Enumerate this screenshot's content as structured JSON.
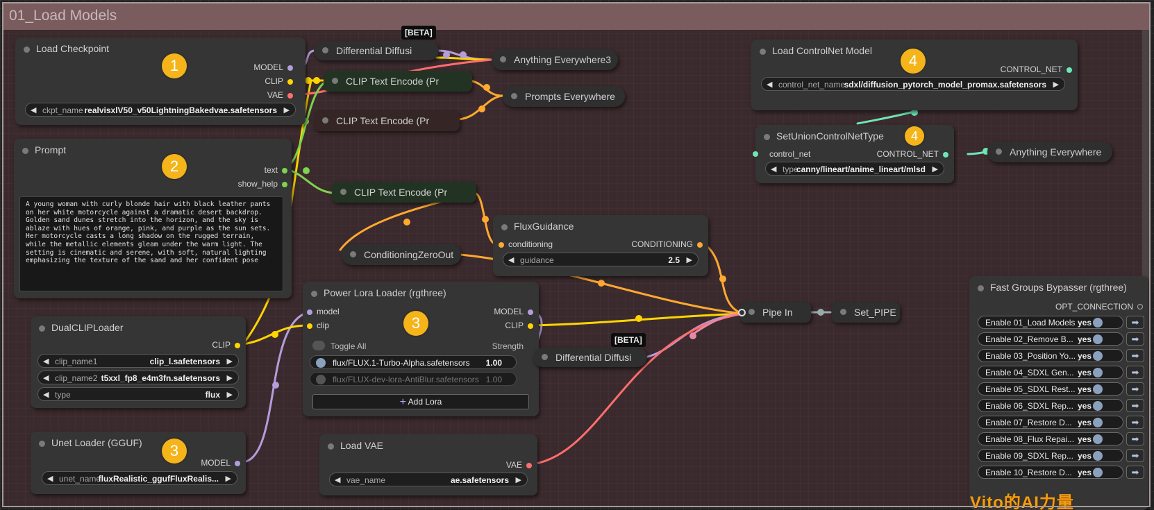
{
  "group": {
    "title": "01_Load Models"
  },
  "badges": {
    "b1": "1",
    "b2": "2",
    "b3a": "3",
    "b3b": "3",
    "b4a": "4",
    "b4b": "4"
  },
  "beta_label": "[BETA]",
  "load_checkpoint": {
    "title": "Load Checkpoint",
    "outputs": [
      "MODEL",
      "CLIP",
      "VAE"
    ],
    "widget": {
      "label": "ckpt_name",
      "value": "realvisxlV50_v50LightningBakedvae.safetensors"
    }
  },
  "prompt": {
    "title": "Prompt",
    "outputs": [
      "text",
      "show_help"
    ],
    "text": "A young woman with curly blonde hair with black leather pants on her white motorcycle against a dramatic desert backdrop. Golden sand dunes stretch into the horizon, and the sky is ablaze with hues of orange, pink, and purple as the sun sets. Her motorcycle casts a long shadow on the rugged terrain, while the metallic elements gleam under the warm light. The setting is cinematic and serene, with soft, natural lighting emphasizing the texture of the sand and her confident pose"
  },
  "differential_diffusion_1": {
    "title": "Differential Diffusi"
  },
  "differential_diffusion_2": {
    "title": "Differential Diffusi"
  },
  "anything_everywhere3": {
    "title": "Anything Everywhere3"
  },
  "clip_text_encode_1": {
    "title": "CLIP Text Encode (Pr"
  },
  "clip_text_encode_2": {
    "title": "CLIP Text Encode (Pr"
  },
  "clip_text_encode_3": {
    "title": "CLIP Text Encode (Pr"
  },
  "prompts_everywhere": {
    "title": "Prompts Everywhere"
  },
  "conditioning_zero_out": {
    "title": "ConditioningZeroOut"
  },
  "flux_guidance": {
    "title": "FluxGuidance",
    "input": "conditioning",
    "output": "CONDITIONING",
    "widget": {
      "label": "guidance",
      "value": "2.5"
    }
  },
  "dual_clip_loader": {
    "title": "DualCLIPLoader",
    "output": "CLIP",
    "widgets": [
      {
        "label": "clip_name1",
        "value": "clip_l.safetensors"
      },
      {
        "label": "clip_name2",
        "value": "t5xxl_fp8_e4m3fn.safetensors"
      },
      {
        "label": "type",
        "value": "flux"
      }
    ]
  },
  "power_lora_loader": {
    "title": "Power Lora Loader (rgthree)",
    "inputs": [
      "model",
      "clip"
    ],
    "outputs": [
      "MODEL",
      "CLIP"
    ],
    "toggle_all": "Toggle All",
    "strength_header": "Strength",
    "loras": [
      {
        "name": "flux/FLUX.1-Turbo-Alpha.safetensors",
        "strength": "1.00",
        "enabled": true
      },
      {
        "name": "flux/FLUX-dev-lora-AntiBlur.safetensors",
        "strength": "1.00",
        "enabled": false
      }
    ],
    "add_lora": "Add Lora"
  },
  "unet_loader": {
    "title": "Unet Loader (GGUF)",
    "output": "MODEL",
    "widget": {
      "label": "unet_name",
      "value": "fluxRealistic_ggufFluxRealis..."
    }
  },
  "load_vae": {
    "title": "Load VAE",
    "output": "VAE",
    "widget": {
      "label": "vae_name",
      "value": "ae.safetensors"
    }
  },
  "pipe_in": {
    "title": "Pipe In"
  },
  "set_pipe": {
    "title": "Set_PIPE"
  },
  "load_controlnet": {
    "title": "Load ControlNet Model",
    "output": "CONTROL_NET",
    "widget": {
      "label": "control_net_name",
      "value": "sdxl/diffusion_pytorch_model_promax.safetensors"
    }
  },
  "set_union_controlnet_type": {
    "title": "SetUnionControlNetType",
    "input": "control_net",
    "output": "CONTROL_NET",
    "widget": {
      "label": "type",
      "value": "canny/lineart/anime_lineart/mlsd"
    }
  },
  "anything_everywhere": {
    "title": "Anything Everywhere"
  },
  "fast_groups_bypasser": {
    "title": "Fast Groups Bypasser (rgthree)",
    "output": "OPT_CONNECTION",
    "yes": "yes",
    "rows": [
      "Enable 01_Load Models",
      "Enable 02_Remove B...",
      "Enable 03_Position Yo...",
      "Enable 04_SDXL Gen...",
      "Enable 05_SDXL Rest...",
      "Enable 06_SDXL Rep...",
      "Enable 07_Restore D...",
      "Enable 08_Flux Repai...",
      "Enable 09_SDXL Rep...",
      "Enable 10_Restore D..."
    ]
  },
  "watermark": "Vito的AI力量",
  "colors": {
    "model": "#b39ddb",
    "clip": "#ffd500",
    "vae": "#ff6e6e",
    "conditioning": "#ffa931",
    "control_net": "#6ee7b7",
    "text": "#7fd34e"
  }
}
